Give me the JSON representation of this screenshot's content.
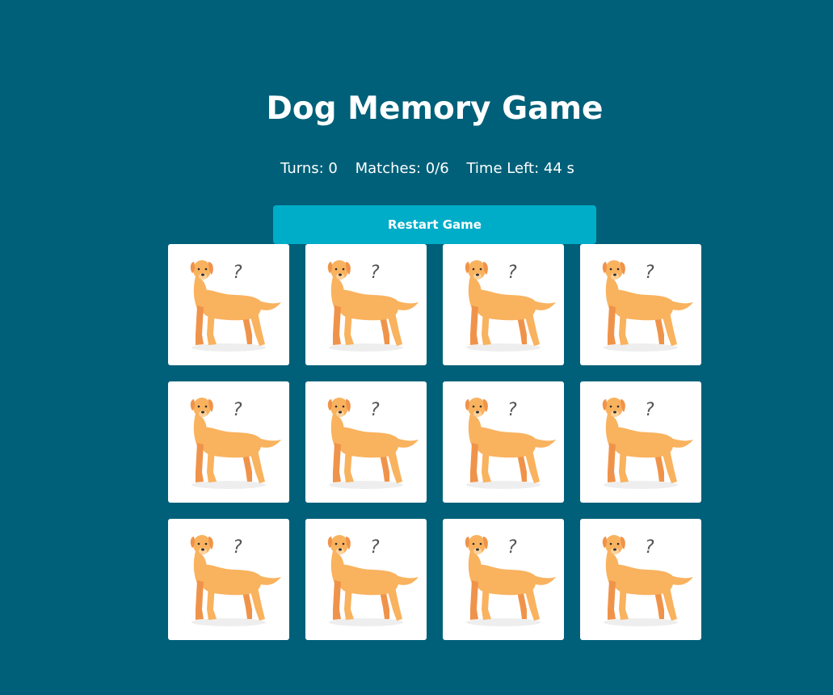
{
  "game": {
    "title": "Dog Memory Game",
    "stats": {
      "turns": "Turns: 0",
      "matches": "Matches: 0/6",
      "time_left": "Time Left: 44 s"
    },
    "restart_label": "Restart Game",
    "card_back_mark": "?",
    "card_back_icon": "dog-icon",
    "cards": [
      {
        "state": "face-down"
      },
      {
        "state": "face-down"
      },
      {
        "state": "face-down"
      },
      {
        "state": "face-down"
      },
      {
        "state": "face-down"
      },
      {
        "state": "face-down"
      },
      {
        "state": "face-down"
      },
      {
        "state": "face-down"
      },
      {
        "state": "face-down"
      },
      {
        "state": "face-down"
      },
      {
        "state": "face-down"
      },
      {
        "state": "face-down"
      }
    ]
  },
  "colors": {
    "background": "#006079",
    "button": "#00adc8",
    "card": "#ffffff",
    "dog_body": "#f9b25e",
    "dog_shadow": "#f0934a"
  }
}
